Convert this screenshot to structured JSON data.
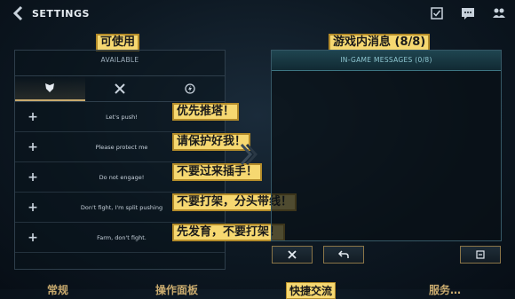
{
  "header": {
    "title": "SETTINGS",
    "back_icon": "back-chevron-icon"
  },
  "top_icons": [
    "missions-icon",
    "chat-icon",
    "friends-icon"
  ],
  "available": {
    "cn_label": "可使用",
    "title": "AVAILABLE",
    "tabs": [
      {
        "icon": "shield-icon",
        "active": true
      },
      {
        "icon": "crossed-swords-icon",
        "active": false
      },
      {
        "icon": "lightning-icon",
        "active": false
      }
    ],
    "rows": [
      {
        "text": "Let's push!",
        "cn": "优先推塔！"
      },
      {
        "text": "Please protect me",
        "cn": "请保护好我！"
      },
      {
        "text": "Do not engage!",
        "cn": "不要过来插手！"
      },
      {
        "text": "Don't fight, I'm split pushing",
        "cn": "不要打架，分头带线！"
      },
      {
        "text": "Farm, don't fight.",
        "cn": "先发育，不要打架！"
      }
    ]
  },
  "ingame": {
    "cn_label": "游戏内消息 (8/8)",
    "title": "IN-GAME MESSAGES (0/8)"
  },
  "buttons": {
    "clear_icon": "x-icon",
    "undo_icon": "undo-icon",
    "save_icon": "save-icon"
  },
  "bottom_labels": [
    "常规",
    "操作面板",
    "快捷交流",
    "服务…"
  ],
  "colors": {
    "accent_gold": "#c8aa6e",
    "label_bg": "#f6d871",
    "teal": "#3d7582"
  }
}
